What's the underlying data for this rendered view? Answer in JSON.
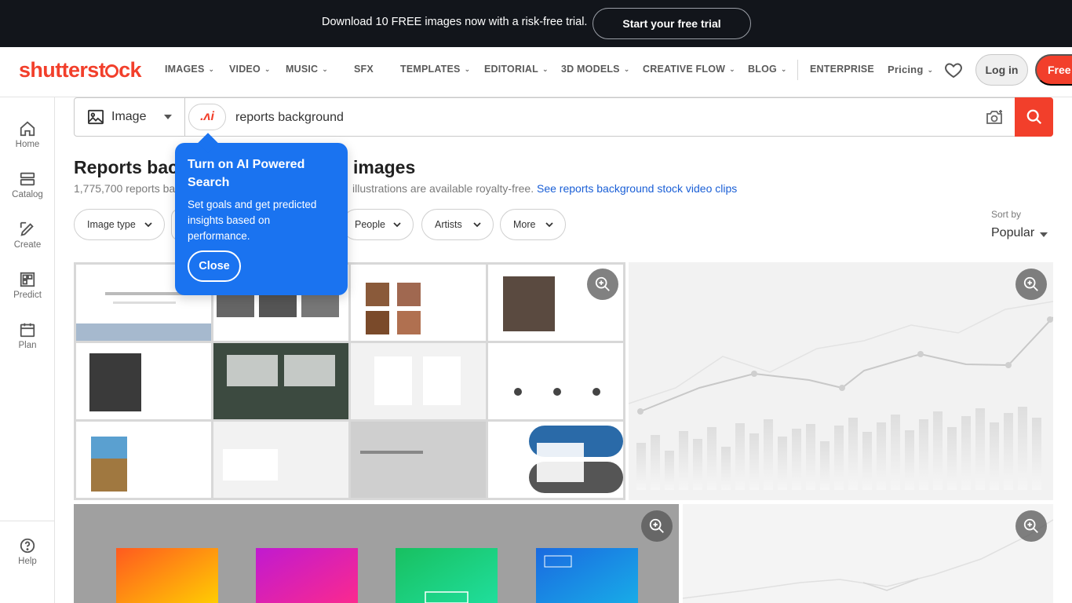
{
  "promo": {
    "text": "Download 10 FREE images now with a risk-free trial.",
    "cta": "Start your free trial"
  },
  "header": {
    "logo": "shutterstock",
    "nav": [
      {
        "label": "IMAGES",
        "has_menu": true
      },
      {
        "label": "VIDEO",
        "has_menu": true
      },
      {
        "label": "MUSIC",
        "has_menu": true
      },
      {
        "label": "SFX",
        "has_menu": false
      },
      {
        "label": "TEMPLATES",
        "has_menu": true
      },
      {
        "label": "EDITORIAL",
        "has_menu": true
      },
      {
        "label": "3D MODELS",
        "has_menu": true
      },
      {
        "label": "CREATIVE FLOW",
        "has_menu": true
      },
      {
        "label": "BLOG",
        "has_menu": true
      },
      {
        "label": "ENTERPRISE",
        "has_menu": false
      },
      {
        "label": "Pricing",
        "has_menu": true
      }
    ],
    "login": "Log in",
    "free_trial": "Free t"
  },
  "sidebar": {
    "items": [
      {
        "label": "Home",
        "icon": "home-icon"
      },
      {
        "label": "Catalog",
        "icon": "catalog-icon"
      },
      {
        "label": "Create",
        "icon": "create-icon"
      },
      {
        "label": "Predict",
        "icon": "predict-icon"
      },
      {
        "label": "Plan",
        "icon": "plan-icon"
      }
    ],
    "help": "Help"
  },
  "search": {
    "type": "Image",
    "query": "reports background",
    "ai_badge": ".ʌi"
  },
  "results": {
    "title_start": "Reports bac",
    "title_end": "images",
    "count_start": "1,775,700 reports ba",
    "count_end": "illustrations are available royalty-free.",
    "video_link": "See reports background stock video clips"
  },
  "filters": [
    "Image type",
    "People",
    "Artists",
    "More"
  ],
  "sort": {
    "label": "Sort by",
    "value": "Popular"
  },
  "tooltip": {
    "title": "Turn on AI Powered Search",
    "body": "Set goals and get predicted insights based on performance.",
    "close": "Close"
  },
  "colors": {
    "brand_red": "#f23f2b",
    "promo_bg": "#12151b",
    "tooltip_blue": "#1a73f0",
    "link_blue": "#1a5fd6"
  }
}
